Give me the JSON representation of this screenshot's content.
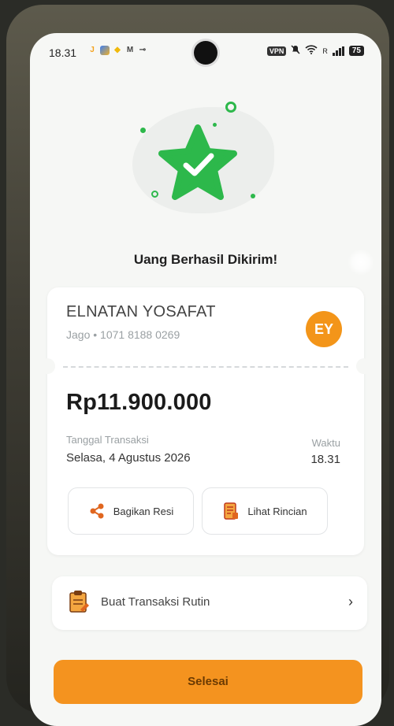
{
  "status_bar": {
    "time": "18.31",
    "vpn": "VPN",
    "signal_label": "R",
    "battery": "75",
    "app_icons": [
      "J-icon",
      "grid-icon",
      "binance-icon",
      "mail-icon",
      "key-icon"
    ]
  },
  "success": {
    "headline": "Uang Berhasil Dikirim!",
    "accent": "#2db84b"
  },
  "transaction": {
    "recipient_name": "ELNATAN YOSAFAT",
    "bank_line": "Jago • 1071 8188 0269",
    "avatar_initials": "EY",
    "avatar_color": "#f39519",
    "amount": "Rp11.900.000",
    "date_label": "Tanggal Transaksi",
    "date_value": "Selasa, 4 Agustus 2026",
    "time_label": "Waktu",
    "time_value": "18.31"
  },
  "actions": {
    "share_label": "Bagikan Resi",
    "detail_label": "Lihat Rincian"
  },
  "routine": {
    "label": "Buat Transaksi Rutin"
  },
  "footer": {
    "done_label": "Selesai",
    "done_color": "#f4931f"
  }
}
